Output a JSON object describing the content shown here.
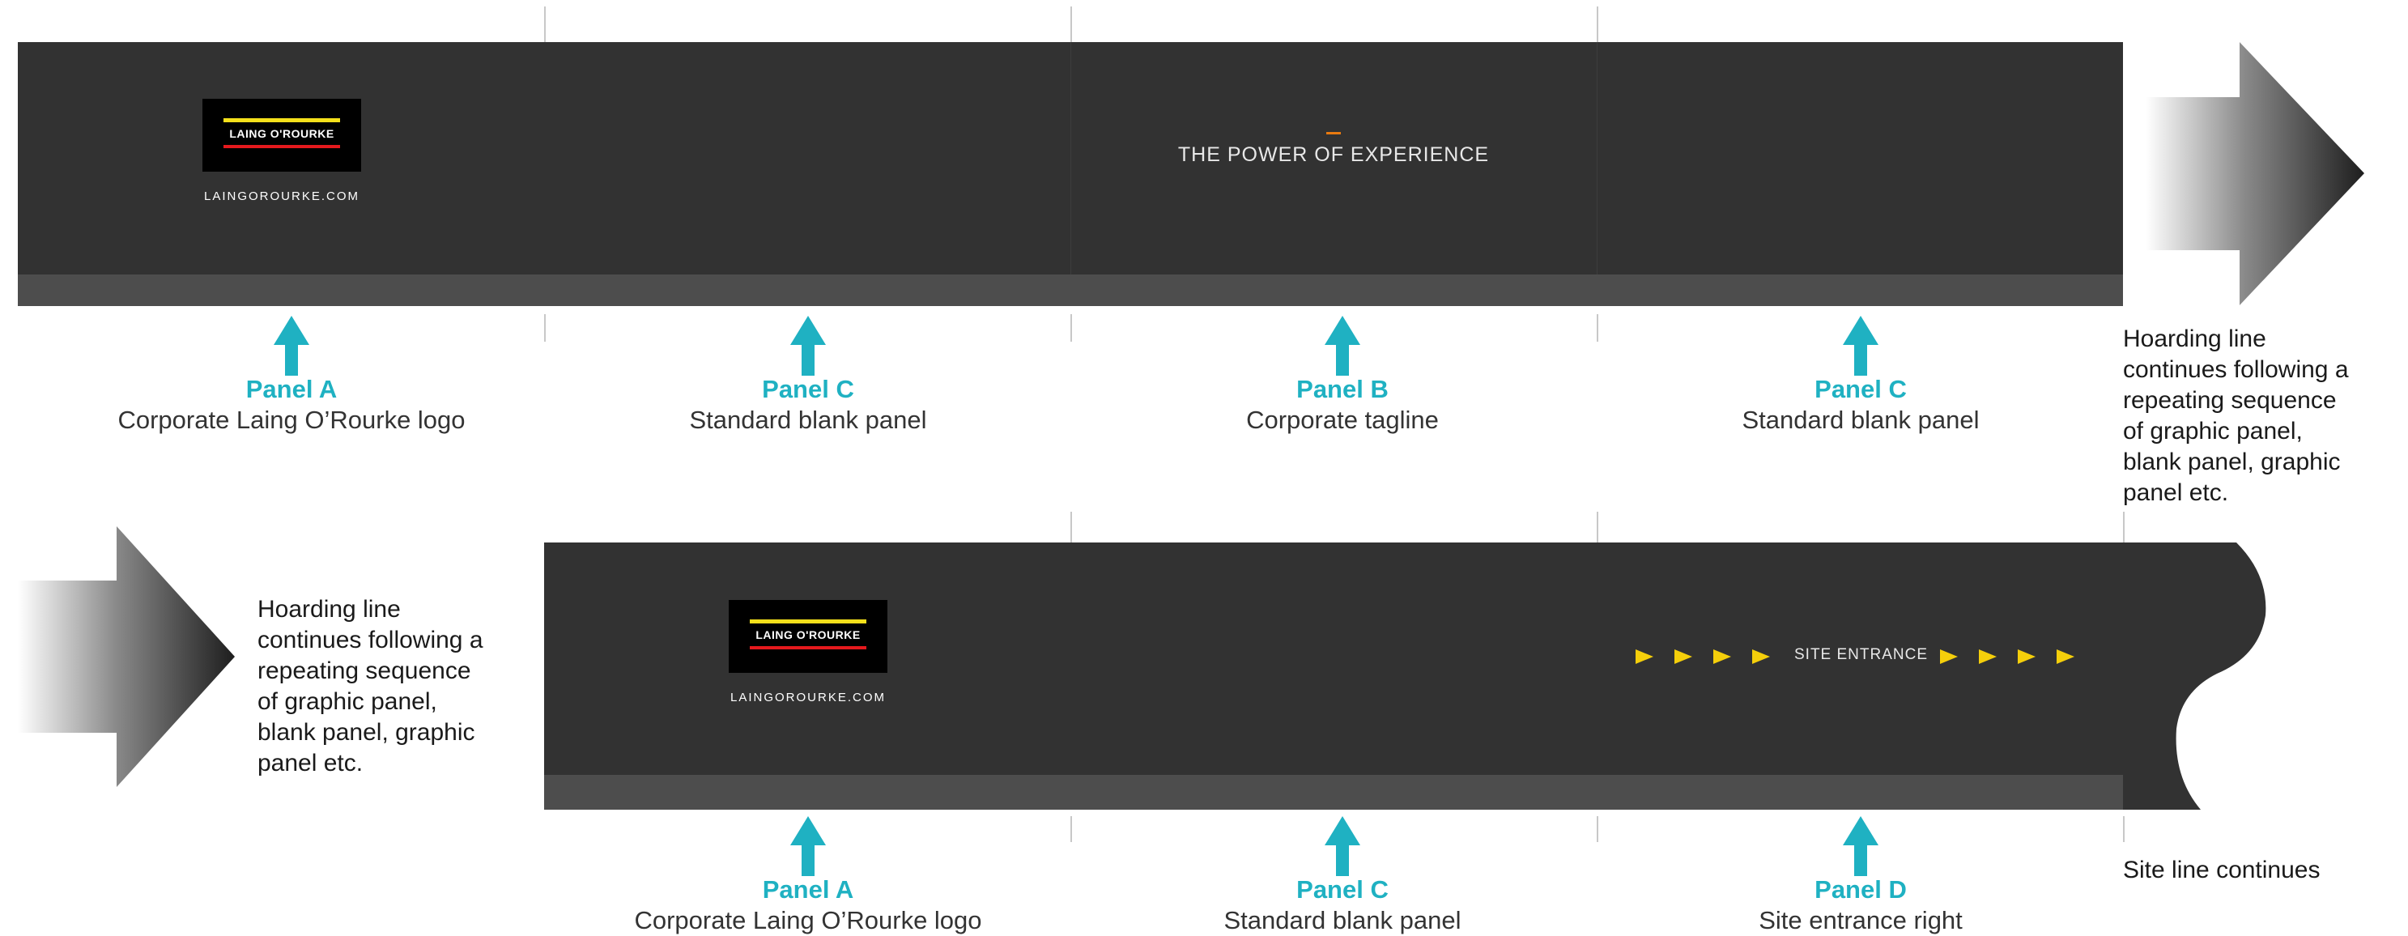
{
  "colors": {
    "panel": "#323232",
    "panel_base": "#4d4d4d",
    "label_accent": "#1fb1c2",
    "logo_yellow": "#f4e01b",
    "logo_red": "#e5191d",
    "site_arrow": "#f5cf0b"
  },
  "logo_text": "LAING O'ROURKE",
  "url_text": "LAINGOROURKE.COM",
  "tagline": "THE POWER OF EXPERIENCE",
  "site_entrance": "SITE ENTRANCE",
  "row1": {
    "labels": [
      {
        "title": "Panel A",
        "desc": "Corporate Laing O’Rourke logo"
      },
      {
        "title": "Panel C",
        "desc": "Standard blank panel"
      },
      {
        "title": "Panel B",
        "desc": "Corporate tagline"
      },
      {
        "title": "Panel C",
        "desc": "Standard blank panel"
      }
    ],
    "note": [
      "Hoarding line",
      "continues following a",
      "repeating sequence",
      "of graphic panel,",
      "blank panel, graphic",
      "panel etc."
    ]
  },
  "row2": {
    "labels": [
      {
        "title": "Panel A",
        "desc": "Corporate Laing O’Rourke logo"
      },
      {
        "title": "Panel C",
        "desc": "Standard blank panel"
      },
      {
        "title": "Panel D",
        "desc": "Site entrance right"
      }
    ],
    "note": [
      "Hoarding line",
      "continues following a",
      "repeating sequence",
      "of graphic panel,",
      "blank panel, graphic",
      "panel etc."
    ],
    "end_note": "Site line continues"
  }
}
